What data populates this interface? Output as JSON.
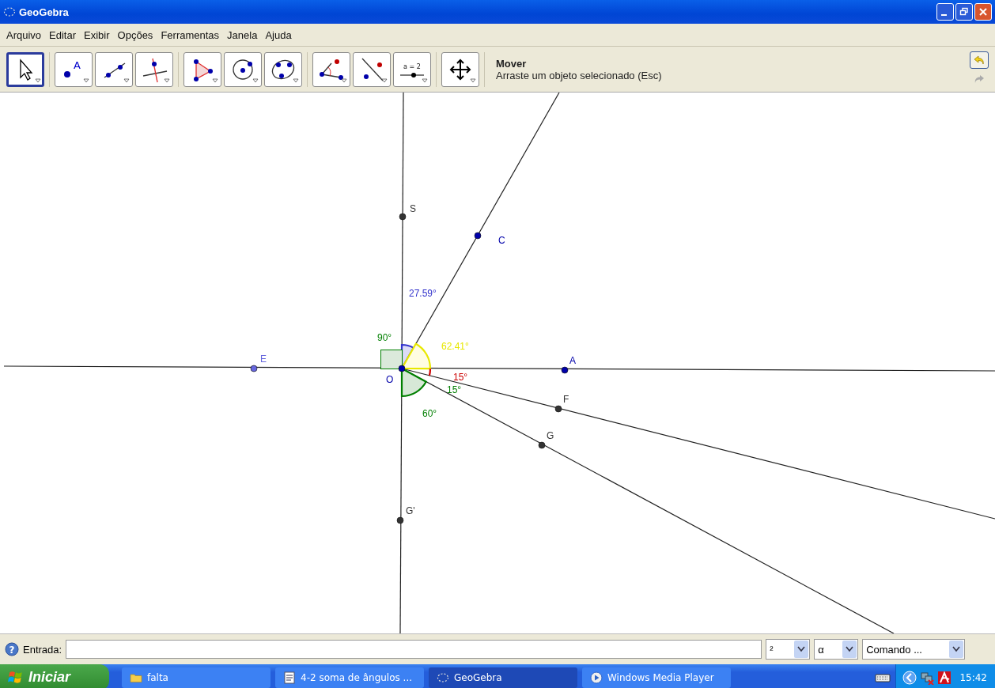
{
  "window": {
    "title": "GeoGebra"
  },
  "menu": [
    "Arquivo",
    "Editar",
    "Exibir",
    "Opções",
    "Ferramentas",
    "Janela",
    "Ajuda"
  ],
  "tool_groups": [
    {
      "tools": [
        {
          "kind": "move",
          "selected": true
        }
      ]
    },
    {
      "tools": [
        {
          "kind": "point",
          "selected": false,
          "label": "A"
        },
        {
          "kind": "segment",
          "selected": false
        },
        {
          "kind": "perpendicular",
          "selected": false
        }
      ]
    },
    {
      "tools": [
        {
          "kind": "polygon",
          "selected": false
        },
        {
          "kind": "circle",
          "selected": false
        },
        {
          "kind": "conic",
          "selected": false
        }
      ]
    },
    {
      "tools": [
        {
          "kind": "angle",
          "selected": false
        },
        {
          "kind": "reflect",
          "selected": false
        },
        {
          "kind": "slider",
          "selected": false,
          "label": "a = 2"
        }
      ]
    },
    {
      "tools": [
        {
          "kind": "pan",
          "selected": false
        }
      ]
    }
  ],
  "tool_info": {
    "name": "Mover",
    "description": "Arraste um objeto selecionado (Esc)"
  },
  "points": [
    {
      "label": "S",
      "color": "#333333"
    },
    {
      "label": "C",
      "color": "#0000aa"
    },
    {
      "label": "E",
      "color": "#6666dd"
    },
    {
      "label": "O",
      "color": "#0000aa"
    },
    {
      "label": "A",
      "color": "#0000aa"
    },
    {
      "label": "F",
      "color": "#333333"
    },
    {
      "label": "G",
      "color": "#333333"
    },
    {
      "label": "G'",
      "color": "#333333"
    }
  ],
  "angles": [
    {
      "label": "27.59°",
      "color": "#3333cc"
    },
    {
      "label": "90°",
      "color": "#007f00"
    },
    {
      "label": "62.41°",
      "color": "#e8e800"
    },
    {
      "label": "15°",
      "color": "#cc0000"
    },
    {
      "label": "15°",
      "color": "#007f00"
    },
    {
      "label": "60°",
      "color": "#007f00"
    }
  ],
  "input_bar": {
    "help": "?",
    "label": "Entrada:",
    "dropdowns": [
      "²",
      "α",
      "Comando ..."
    ]
  },
  "taskbar": {
    "start": "Iniciar",
    "tasks": [
      {
        "kind": "folder",
        "label": "falta",
        "selected": false
      },
      {
        "kind": "document",
        "label": "4-2 soma de ângulos ...",
        "selected": false
      },
      {
        "kind": "geogebra",
        "label": "GeoGebra",
        "selected": true
      },
      {
        "kind": "media",
        "label": "Windows Media Player",
        "selected": false
      }
    ],
    "clock": "15:42"
  }
}
